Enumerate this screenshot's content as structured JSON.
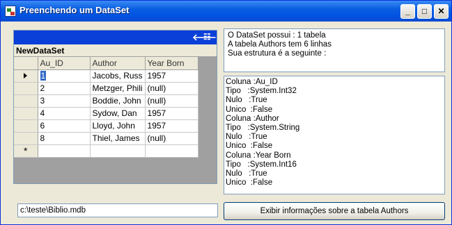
{
  "window": {
    "title": "Preenchendo um DataSet",
    "buttons": {
      "minimize": "_",
      "maximize": "□",
      "close": "✕"
    }
  },
  "grid": {
    "nav_back_icon": "arrow-left-icon",
    "nav_details_icon": "show-parent-rows-icon",
    "parent_label": "NewDataSet",
    "columns": [
      "Au_ID",
      "Author",
      "Year Born"
    ],
    "rows": [
      {
        "au_id": "1",
        "author": "Jacobs, Russ",
        "year": "1957",
        "current": true
      },
      {
        "au_id": "2",
        "author": "Metzger, Phili",
        "year": "(null)"
      },
      {
        "au_id": "3",
        "author": "Boddie, John",
        "year": "(null)"
      },
      {
        "au_id": "4",
        "author": "Sydow, Dan",
        "year": "1957"
      },
      {
        "au_id": "6",
        "author": "Lloyd, John",
        "year": "1957"
      },
      {
        "au_id": "8",
        "author": "Thiel, James",
        "year": "(null)"
      }
    ],
    "new_row_marker": "*"
  },
  "info": {
    "lines": [
      "O DataSet possui : 1 tabela",
      "A tabela Authors tem 6 linhas",
      "Sua estrutura é a seguinte :"
    ]
  },
  "structure": {
    "lines": [
      "Coluna :Au_ID",
      "Tipo   :System.Int32",
      "Nulo   :True",
      "Unico  :False",
      "Coluna :Author",
      "Tipo   :System.String",
      "Nulo   :True",
      "Unico  :False",
      "Coluna :Year Born",
      "Tipo   :System.Int16",
      "Nulo   :True",
      "Unico  :False"
    ]
  },
  "path_field": {
    "value": "c:\\teste\\Biblio.mdb"
  },
  "show_button": {
    "label": "Exibir informações sobre a tabela Authors"
  }
}
